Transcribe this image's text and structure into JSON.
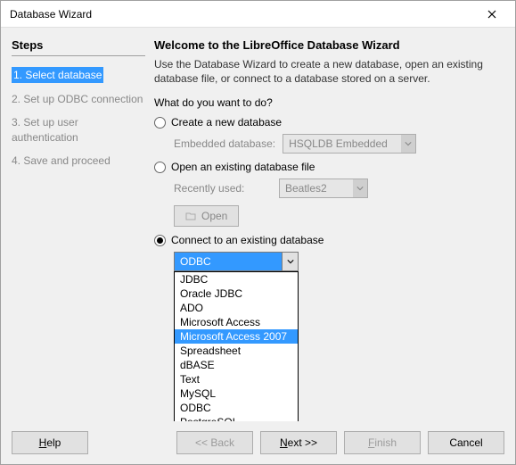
{
  "window": {
    "title": "Database Wizard"
  },
  "sidebar": {
    "heading": "Steps",
    "items": [
      {
        "label": "1. Select database",
        "current": true
      },
      {
        "label": "2. Set up ODBC connection",
        "current": false
      },
      {
        "label": "3. Set up user authentication",
        "current": false
      },
      {
        "label": "4. Save and proceed",
        "current": false
      }
    ]
  },
  "main": {
    "title": "Welcome to the LibreOffice Database Wizard",
    "desc": "Use the Database Wizard to create a new database, open an existing database file, or connect to a database stored on a server.",
    "question": "What do you want to do?",
    "opt_create": {
      "label": "Create a new database",
      "sublabel": "Embedded database:",
      "select_value": "HSQLDB Embedded"
    },
    "opt_open": {
      "label": "Open an existing database file",
      "sublabel": "Recently used:",
      "select_value": "Beatles2",
      "open_btn": "Open"
    },
    "opt_connect": {
      "label": "Connect to an existing database",
      "select_value": "ODBC",
      "dropdown": [
        "JDBC",
        "Oracle JDBC",
        "ADO",
        "Microsoft Access",
        "Microsoft Access 2007",
        "Spreadsheet",
        "dBASE",
        "Text",
        "MySQL",
        "ODBC",
        "PostgreSQL"
      ],
      "highlight_index": 4
    }
  },
  "footer": {
    "help": "Help",
    "back": "<< Back",
    "next": "Next >>",
    "finish": "Finish",
    "cancel": "Cancel"
  }
}
